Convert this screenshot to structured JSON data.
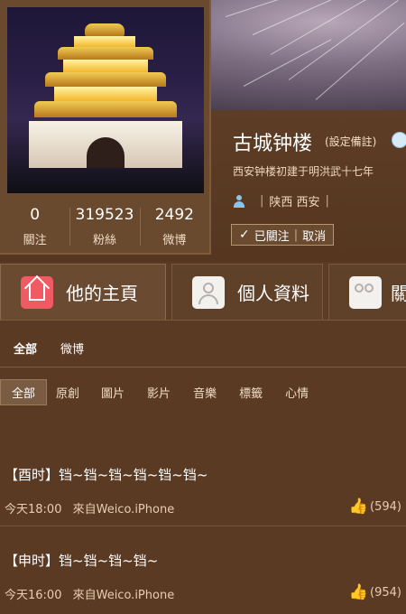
{
  "profile": {
    "name": "古城钟楼",
    "name_note": "(設定備註)",
    "bio": "西安钟楼初建于明洪武十七年",
    "location_separator_left": "|",
    "location": "陕西 西安",
    "location_separator_right": "|",
    "follow_button": {
      "check": "✓",
      "label": "已關注",
      "divider": "|",
      "cancel": "取消"
    },
    "stats": [
      {
        "value": "0",
        "label": "關注"
      },
      {
        "value": "319523",
        "label": "粉絲"
      },
      {
        "value": "2492",
        "label": "微博"
      }
    ]
  },
  "tabs": [
    {
      "label": "他的主頁",
      "icon": "home-icon"
    },
    {
      "label": "個人資料",
      "icon": "profile-icon"
    },
    {
      "label": "關",
      "icon": "group-icon"
    }
  ],
  "subnav_primary": [
    "全部",
    "微博"
  ],
  "subnav_filters": [
    "全部",
    "原創",
    "圖片",
    "影片",
    "音樂",
    "標籤",
    "心情"
  ],
  "posts": [
    {
      "text": "【酉时】铛~铛~铛~铛~铛~铛~",
      "time": "今天18:00",
      "source": "來自Weico.iPhone",
      "likes": "(594)"
    },
    {
      "text": "【申时】铛~铛~铛~铛~",
      "time": "今天16:00",
      "source": "來自Weico.iPhone",
      "likes": "(954)"
    }
  ],
  "colors": {
    "page_background": "#5a3a23",
    "accent_home": "#ef5a63",
    "thumb_blue": "#8cc1ea"
  }
}
